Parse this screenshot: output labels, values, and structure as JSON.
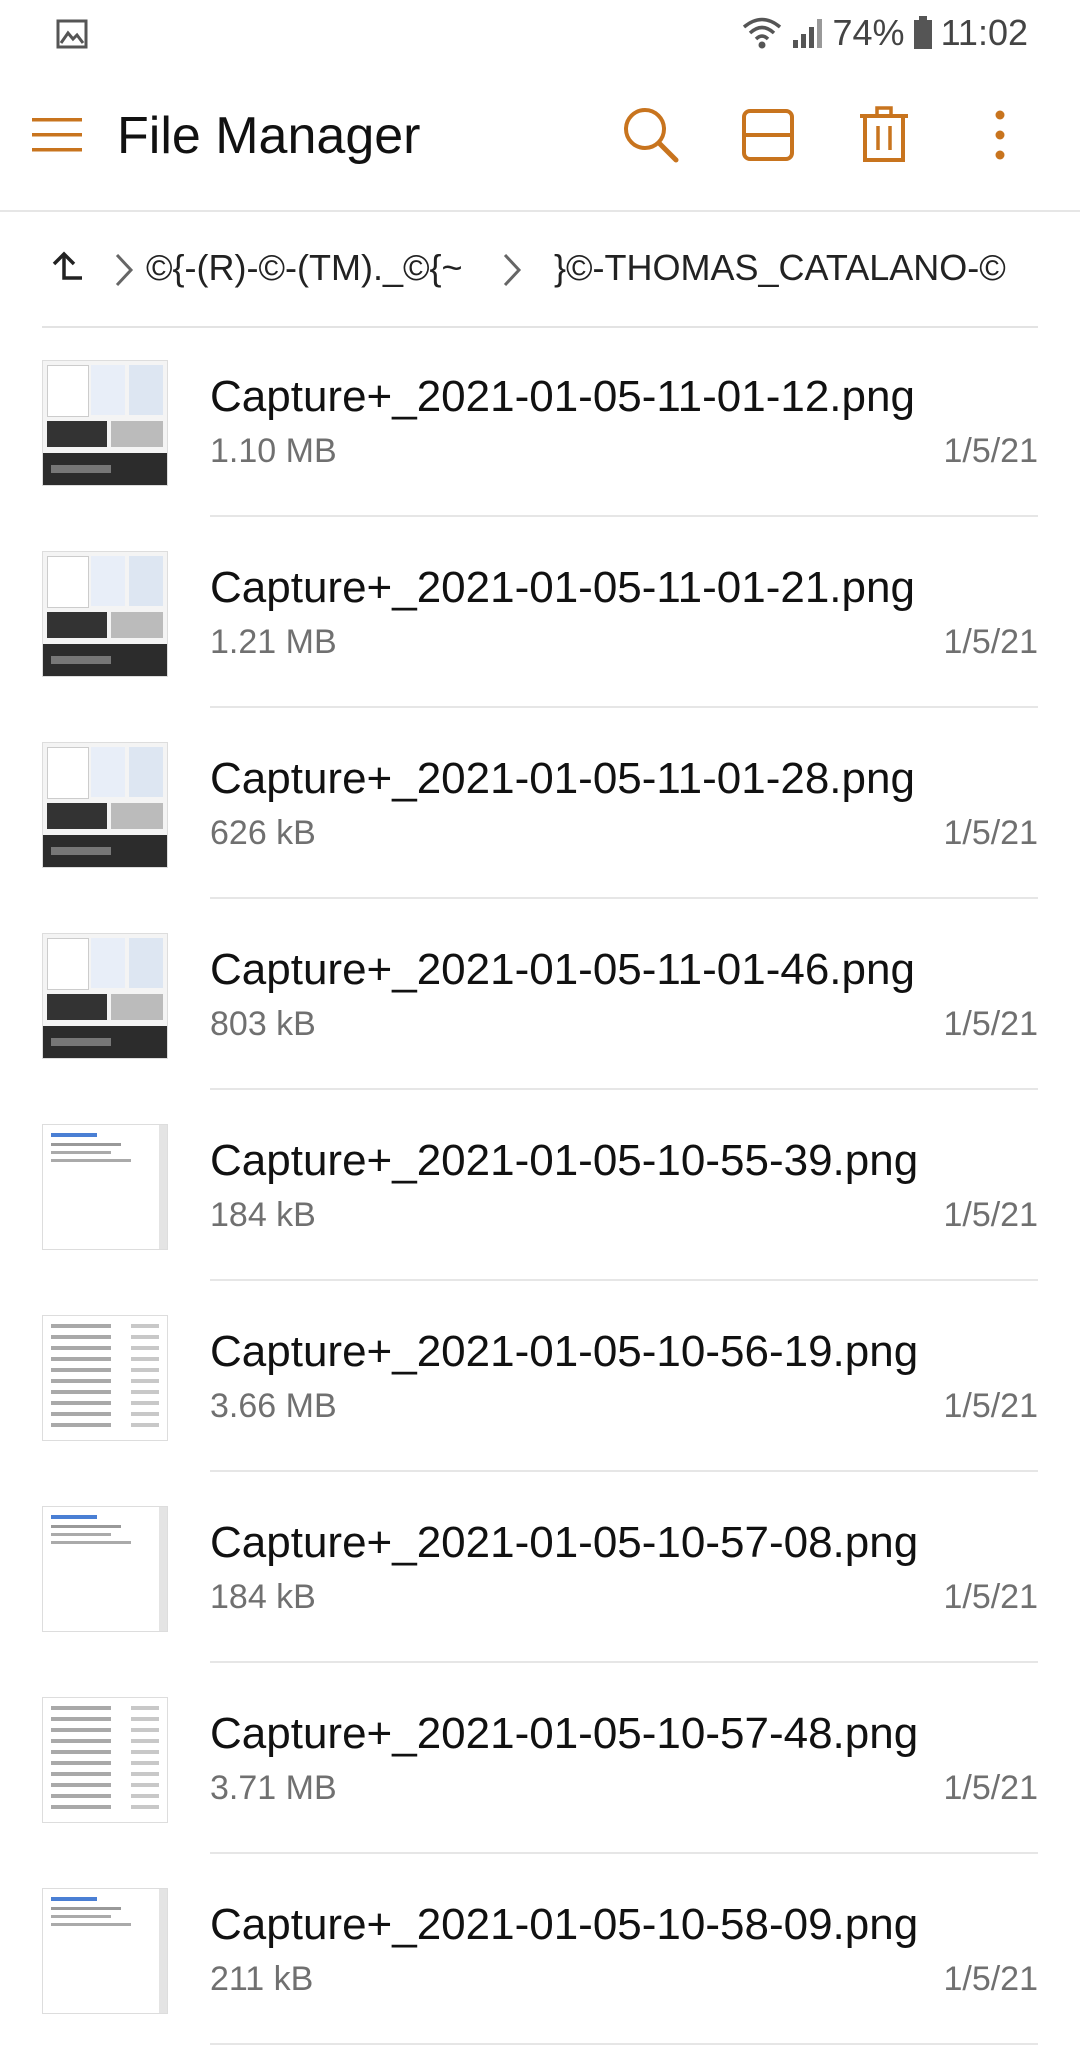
{
  "status_bar": {
    "left_icon": "image-notification-icon",
    "battery_percent": "74%",
    "time": "11:02"
  },
  "toolbar": {
    "title": "File Manager",
    "accent_color": "#c8741e",
    "icons": [
      "menu-icon",
      "search-icon",
      "view-layout-icon",
      "trash-icon",
      "more-vert-icon"
    ]
  },
  "breadcrumb": {
    "segments": [
      "©{-(R)-©-(TM)._©{~",
      "}©-THOMAS_CATALANO-©"
    ]
  },
  "files": [
    {
      "name": "Capture+_2021-01-05-11-01-12.png",
      "size": "1.10 MB",
      "date": "1/5/21",
      "thumb": "dark"
    },
    {
      "name": "Capture+_2021-01-05-11-01-21.png",
      "size": "1.21 MB",
      "date": "1/5/21",
      "thumb": "dark"
    },
    {
      "name": "Capture+_2021-01-05-11-01-28.png",
      "size": "626 kB",
      "date": "1/5/21",
      "thumb": "dark"
    },
    {
      "name": "Capture+_2021-01-05-11-01-46.png",
      "size": "803 kB",
      "date": "1/5/21",
      "thumb": "dark"
    },
    {
      "name": "Capture+_2021-01-05-10-55-39.png",
      "size": "184 kB",
      "date": "1/5/21",
      "thumb": "light"
    },
    {
      "name": "Capture+_2021-01-05-10-56-19.png",
      "size": "3.66 MB",
      "date": "1/5/21",
      "thumb": "list"
    },
    {
      "name": "Capture+_2021-01-05-10-57-08.png",
      "size": "184 kB",
      "date": "1/5/21",
      "thumb": "light"
    },
    {
      "name": "Capture+_2021-01-05-10-57-48.png",
      "size": "3.71 MB",
      "date": "1/5/21",
      "thumb": "list"
    },
    {
      "name": "Capture+_2021-01-05-10-58-09.png",
      "size": "211 kB",
      "date": "1/5/21",
      "thumb": "light"
    }
  ]
}
